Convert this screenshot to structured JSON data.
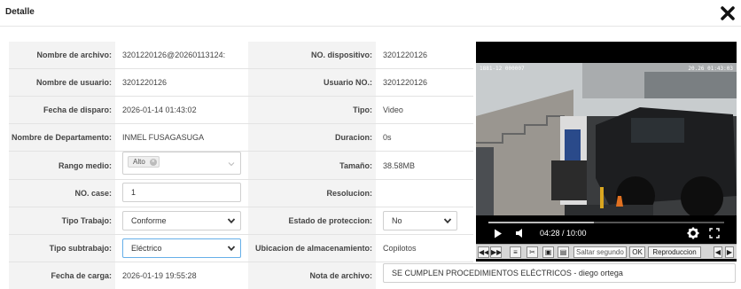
{
  "dialog": {
    "title": "Detalle",
    "close_icon": "close-icon"
  },
  "form": {
    "archivo_label": "Nombre de archivo:",
    "archivo_value": "3201220126@20260113124:",
    "dispositivo_label": "NO. dispositivo:",
    "dispositivo_value": "3201220126",
    "usuario_label": "Nombre de usuario:",
    "usuario_value": "3201220126",
    "usuario_no_label": "Usuario NO.:",
    "usuario_no_value": "3201220126",
    "disparo_label": "Fecha de disparo:",
    "disparo_value": "2026-01-14 01:43:02",
    "tipo_label": "Tipo:",
    "tipo_value": "Video",
    "departamento_label": "Nombre de Departamento:",
    "departamento_value": "INMEL FUSAGASUGA",
    "duracion_label": "Duracion:",
    "duracion_value": "0s",
    "rango_label": "Rango medio:",
    "rango_tag": "Alto",
    "tamano_label": "Tamaño:",
    "tamano_value": "38.58MB",
    "case_label": "NO. case:",
    "case_value": "1",
    "resolucion_label": "Resolucion:",
    "resolucion_value": "",
    "trabajo_label": "Tipo Trabajo:",
    "trabajo_value": "Conforme",
    "proteccion_label": "Estado de proteccion:",
    "proteccion_value": "No",
    "subtrabajo_label": "Tipo subtrabajo:",
    "subtrabajo_value": "Eléctrico",
    "ubicacion_label": "Ubicacion de almacenamiento:",
    "ubicacion_value": "Copilotos",
    "carga_label": "Fecha de carga:",
    "carga_value": "2026-01-19 19:55:28",
    "nota_label": "Nota de archivo:",
    "nota_value": "SE CUMPLEN PROCEDIMIENTOS ELÉCTRICOS - diego ortega"
  },
  "video": {
    "osd_left": "1881-12 000007",
    "osd_right": "20.26 01:43:03",
    "time": "04:28 / 10:00",
    "progress": 0.447,
    "toolbar": {
      "jump_placeholder": "Saltar segundo",
      "ok_label": "OK",
      "rate_label": "Reproduccion"
    }
  },
  "colors": {
    "focus_border": "#66afe9",
    "label_bg": "#f3f3f3",
    "video_bg": "#000000"
  }
}
